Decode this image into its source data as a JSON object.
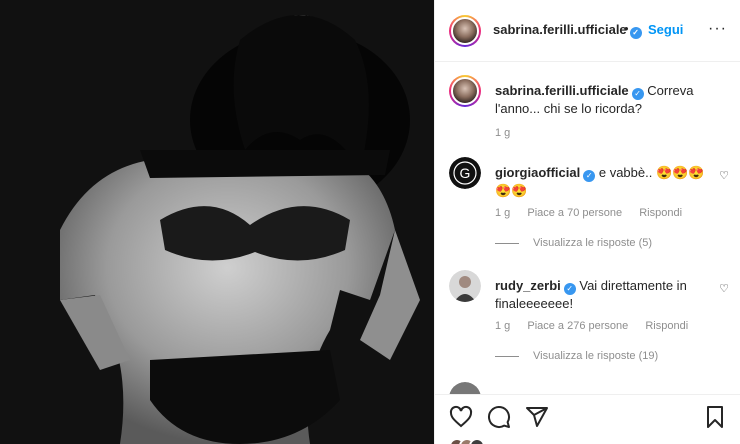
{
  "post": {
    "author": "sabrina.ferilli.ufficiale",
    "dot": "•",
    "follow_label": "Segui",
    "more_label": "···"
  },
  "caption": {
    "author": "sabrina.ferilli.ufficiale",
    "text": "Correva l'anno... chi se lo ricorda?",
    "time": "1 g"
  },
  "comments": [
    {
      "author": "giorgiaofficial",
      "text": "e vabbè.. 😍😍😍😍😍",
      "time": "1 g",
      "likes": "Piace a 70 persone",
      "reply": "Rispondi",
      "view_replies": "Visualizza le risposte (5)"
    },
    {
      "author": "rudy_zerbi",
      "text": "Vai direttamente in finaleeeeeee!",
      "time": "1 g",
      "likes": "Piace a 276 persone",
      "reply": "Rispondi",
      "view_replies": "Visualizza le risposte (19)"
    }
  ],
  "icons": {
    "heart": "heart-icon",
    "comment": "comment-icon",
    "share": "share-icon",
    "save": "bookmark-icon",
    "verified": "verified-badge-icon"
  },
  "colors": {
    "link_blue": "#0095f6",
    "verified_blue": "#3897f0",
    "muted_text": "#8e8e8e"
  }
}
